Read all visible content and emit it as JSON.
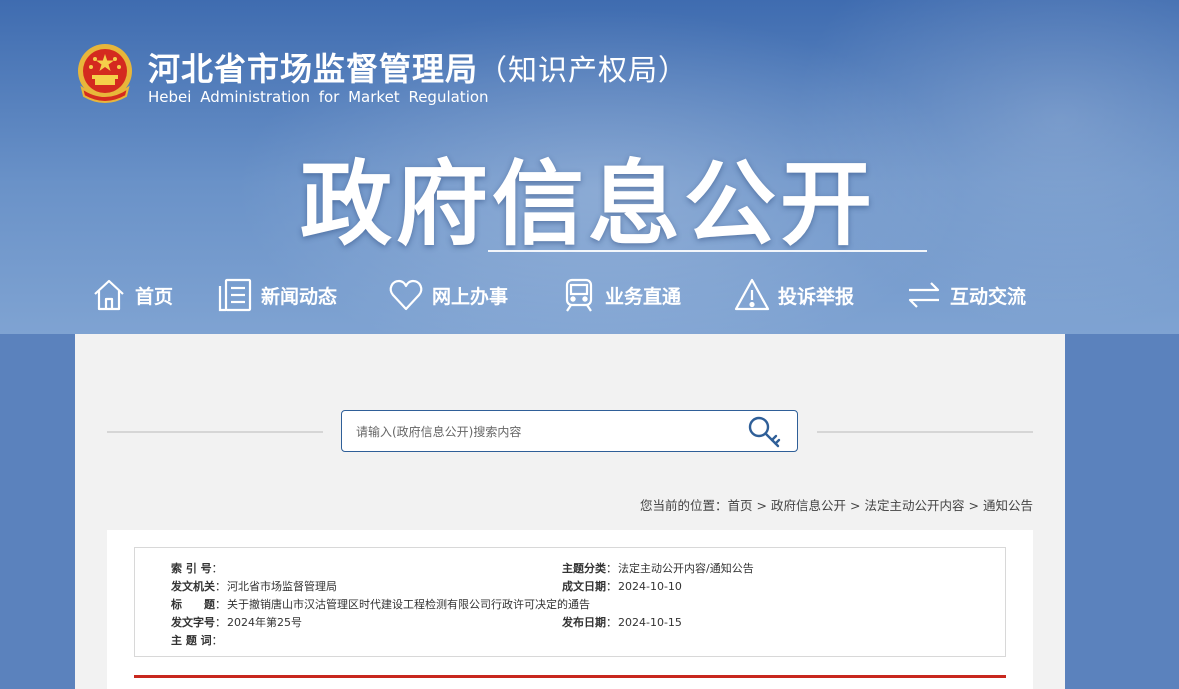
{
  "header": {
    "title": "河北省市场监督管理局",
    "title_suffix": "（知识产权局）",
    "subtitle_en": "Hebei Administration for Market Regulation",
    "banner": "政府信息公开"
  },
  "nav": [
    {
      "label": "首页",
      "icon": "home-icon"
    },
    {
      "label": "新闻动态",
      "icon": "news-icon"
    },
    {
      "label": "网上办事",
      "icon": "heart-icon"
    },
    {
      "label": "业务直通",
      "icon": "train-icon"
    },
    {
      "label": "投诉举报",
      "icon": "warning-icon"
    },
    {
      "label": "互动交流",
      "icon": "exchange-icon"
    }
  ],
  "search": {
    "placeholder": "请输入(政府信息公开)搜索内容"
  },
  "breadcrumb": {
    "prefix": "您当前的位置：",
    "items": [
      "首页",
      "政府信息公开",
      "法定主动公开内容",
      "通知公告"
    ],
    "separator": ">"
  },
  "meta": {
    "index_no": {
      "label": "索 引 号",
      "value": ""
    },
    "category": {
      "label": "主题分类",
      "value": "法定主动公开内容/通知公告"
    },
    "issuer": {
      "label": "发文机关",
      "value": "河北省市场监督管理局"
    },
    "date_created": {
      "label": "成文日期",
      "value": "2024-10-10"
    },
    "title": {
      "label": "标　　题",
      "value": "关于撤销唐山市汉沽管理区时代建设工程检测有限公司行政许可决定的通告"
    },
    "doc_no": {
      "label": "发文字号",
      "value": "2024年第25号"
    },
    "date_published": {
      "label": "发布日期",
      "value": "2024-10-15"
    },
    "keywords": {
      "label": "主 题 词",
      "value": ""
    }
  },
  "colors": {
    "accent_blue": "#2f5f98",
    "red_bar": "#c8281e",
    "content_bg": "#f2f2f2"
  }
}
